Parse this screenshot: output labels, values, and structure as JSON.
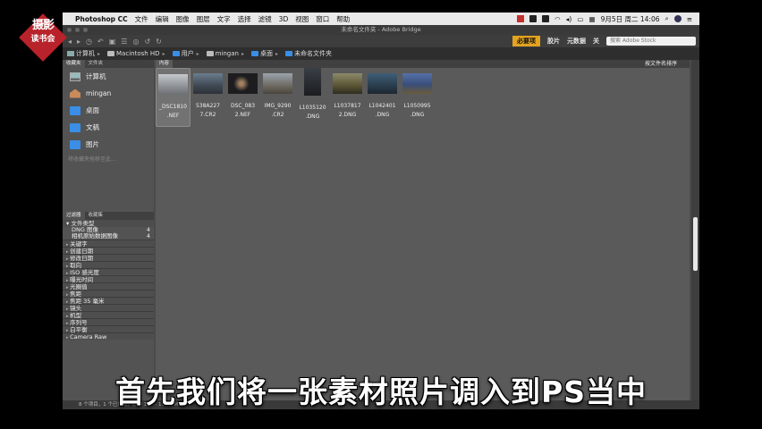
{
  "menubar": {
    "app": "Photoshop CC",
    "items": [
      "文件",
      "编辑",
      "图像",
      "图层",
      "文字",
      "选择",
      "滤镜",
      "3D",
      "视图",
      "窗口",
      "帮助"
    ],
    "clock": "9月5日 周二 14:06"
  },
  "window": {
    "title": "未命名文件夹 - Adobe Bridge"
  },
  "toolbar": {
    "workspaces": {
      "active": "必要项",
      "items": [
        "胶片",
        "元数据",
        "关"
      ]
    },
    "search_placeholder": "搜索 Adobe Stock"
  },
  "breadcrumb": [
    "计算机",
    "Macintosh HD",
    "用户",
    "mingan",
    "桌面",
    "未命名文件夹"
  ],
  "favorites": {
    "tabs": [
      "收藏夹",
      "文件夹"
    ],
    "items": [
      {
        "label": "计算机",
        "icon": "computer-icon"
      },
      {
        "label": "mingan",
        "icon": "home-icon"
      },
      {
        "label": "桌面",
        "icon": "folder-icon"
      },
      {
        "label": "文稿",
        "icon": "folder-icon"
      },
      {
        "label": "图片",
        "icon": "folder-icon"
      }
    ],
    "hint": "将收藏夹拖移至此..."
  },
  "filter": {
    "tabs": [
      "过滤器",
      "收藏集"
    ],
    "section": "文件类型",
    "file_types": [
      {
        "label": "DNG 图像",
        "count": "4"
      },
      {
        "label": "相机原始数据图像",
        "count": "4"
      }
    ],
    "criteria": [
      "关键字",
      "创建日期",
      "修改日期",
      "取向",
      "ISO 感光度",
      "曝光时间",
      "光圈值",
      "焦距",
      "焦距 35 毫米",
      "镜头",
      "机型",
      "序列号",
      "白平衡",
      "Camera Raw"
    ]
  },
  "content": {
    "tab": "内容",
    "sort_label": "按文件名排序",
    "files": [
      {
        "line1": "_DSC1810",
        "line2": ".NEF",
        "selected": true
      },
      {
        "line1": "538A227",
        "line2": "7.CR2"
      },
      {
        "line1": "DSC_083",
        "line2": "2.NEF"
      },
      {
        "line1": "IMG_9290",
        "line2": ".CR2"
      },
      {
        "line1": "L1035120",
        "line2": ".DNG"
      },
      {
        "line1": "L1037817",
        "line2": "2.DNG"
      },
      {
        "line1": "L1042401",
        "line2": ".DNG"
      },
      {
        "line1": "L1050995",
        "line2": ".DNG"
      }
    ]
  },
  "status": "8 个项目，1 个已隐藏，选中 1 个 - 19.80 MB",
  "logo": {
    "line1": "摄影",
    "line2": "读书会"
  },
  "subtitle": "首先我们将一张素材照片调入到PS当中",
  "colors": {
    "accent": "#e3a320",
    "folder": "#3a8ee6",
    "logo": "#b8222a"
  }
}
